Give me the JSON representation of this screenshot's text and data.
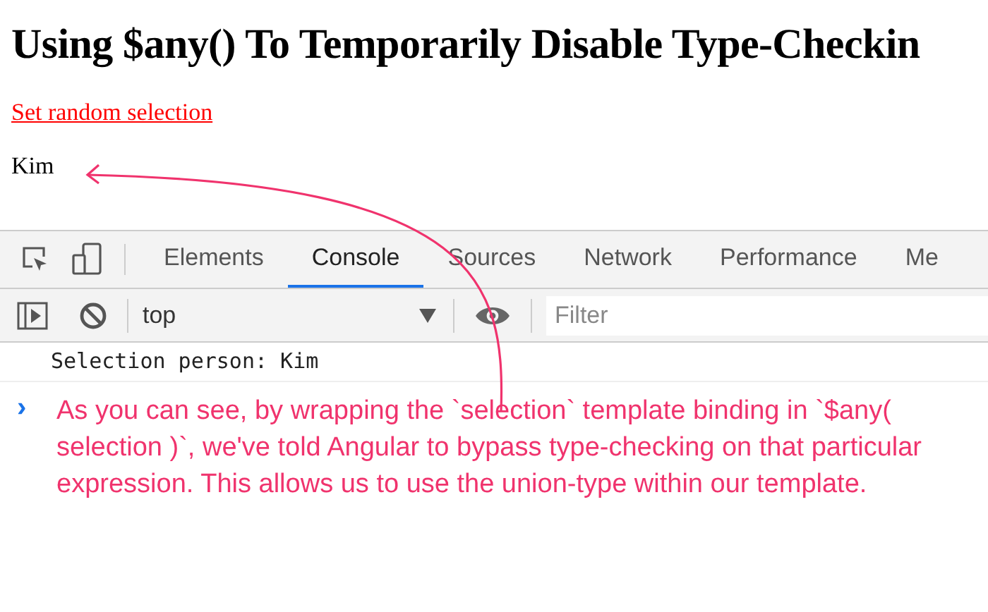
{
  "page": {
    "heading": "Using $any() To Temporarily Disable Type-Checkin",
    "link": "Set random selection",
    "selection_value": "Kim"
  },
  "devtools": {
    "tabs": [
      {
        "label": "Elements",
        "selected": false
      },
      {
        "label": "Console",
        "selected": true
      },
      {
        "label": "Sources",
        "selected": false
      },
      {
        "label": "Network",
        "selected": false
      },
      {
        "label": "Performance",
        "selected": false
      },
      {
        "label": "Me",
        "selected": false
      }
    ],
    "context": "top",
    "filter": {
      "placeholder": "Filter"
    },
    "console_lines": [
      "Selection person: Kim"
    ],
    "prompt": "›"
  },
  "annotation": "As you can see, by wrapping the `selection` template binding in `$any( selection )`, we've told Angular to bypass type-checking on that particular expression. This allows us to use the union-type within our template."
}
